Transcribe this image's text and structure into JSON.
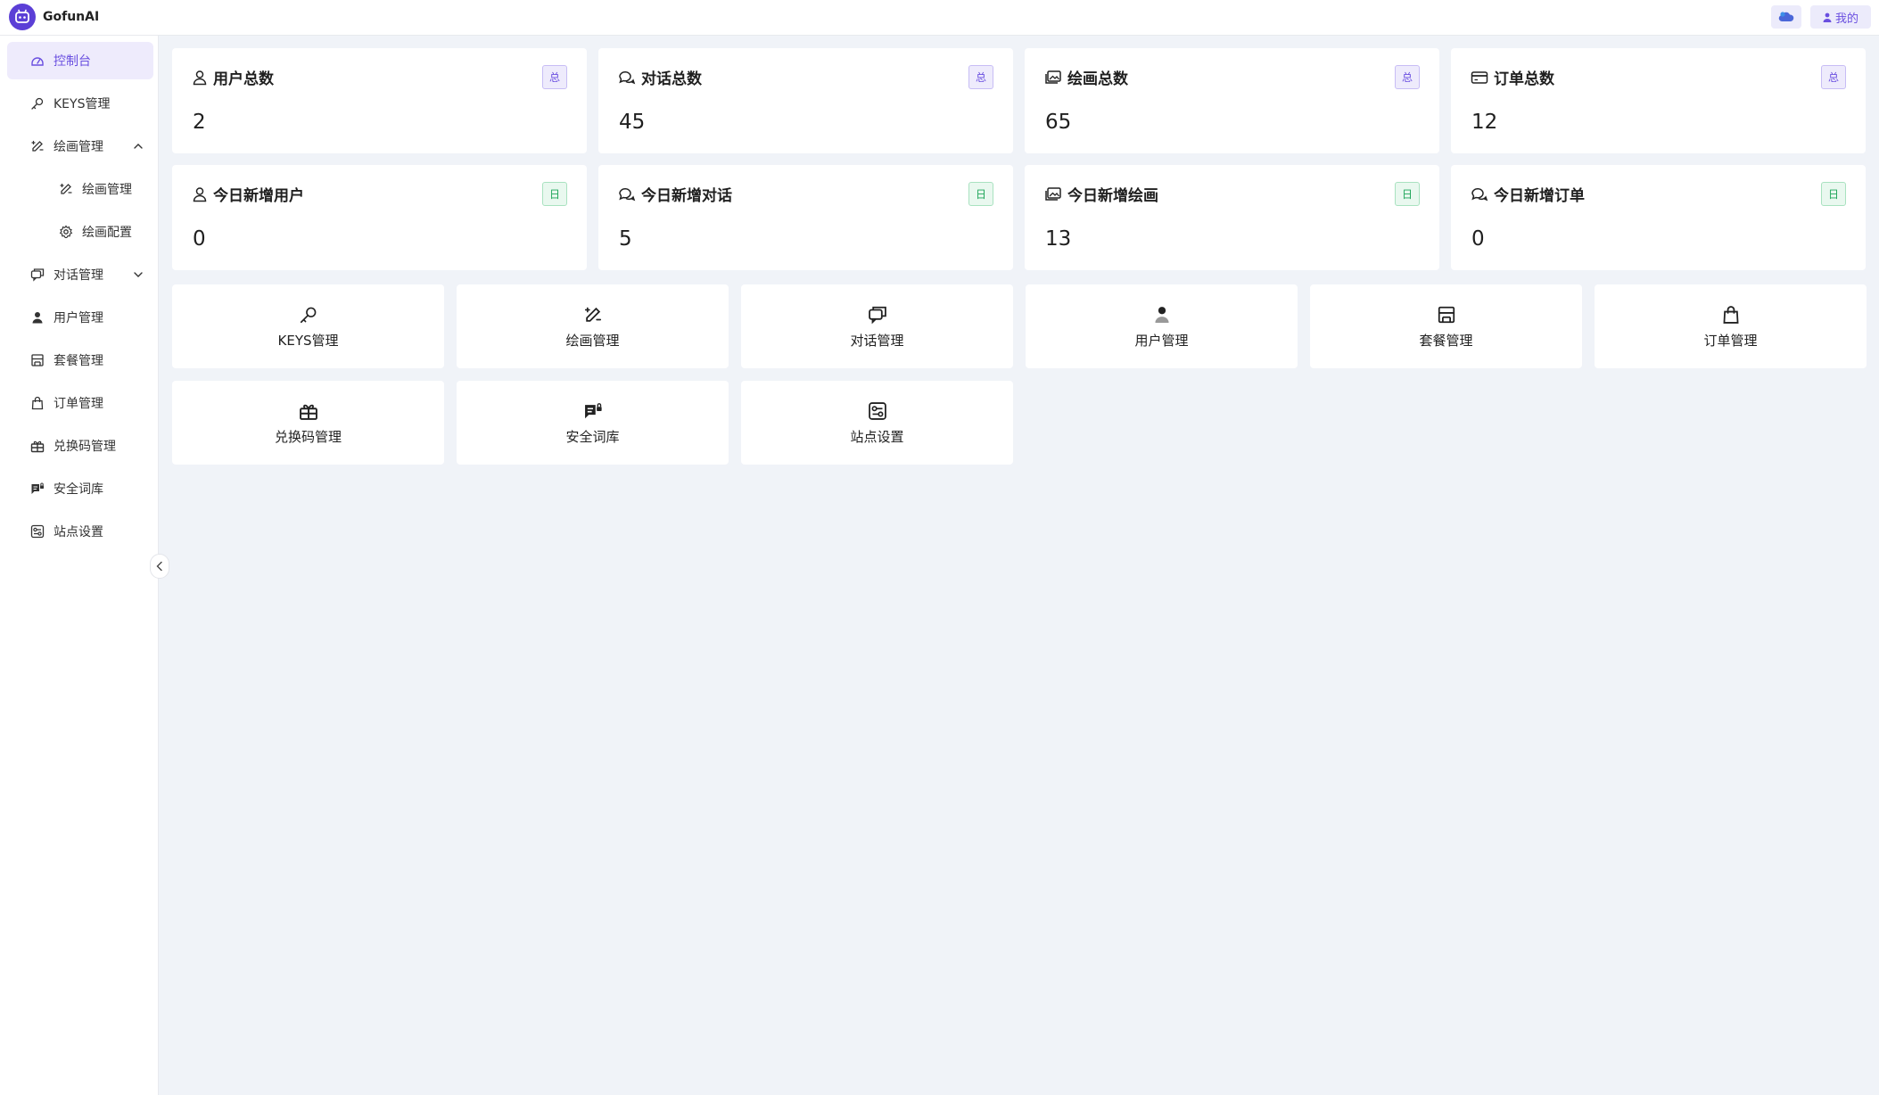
{
  "app": {
    "name": "GofunAI",
    "my_label": "我的"
  },
  "colors": {
    "accent": "#6a4fe0",
    "logo_bg": "#5b3fd6",
    "tag_total_bg": "#eeebfc",
    "tag_day_bg": "#e9f8ef",
    "tag_day_text": "#1fa65a",
    "page_bg": "#f0f3f8"
  },
  "sidebar": {
    "items": [
      {
        "label": "控制台",
        "icon": "dashboard-icon",
        "active": true
      },
      {
        "label": "KEYS管理",
        "icon": "key-icon"
      },
      {
        "label": "绘画管理",
        "icon": "draw-icon",
        "expanded": true
      },
      {
        "label": "绘画管理",
        "icon": "draw-icon",
        "sub": true
      },
      {
        "label": "绘画配置",
        "icon": "gear-icon",
        "sub": true
      },
      {
        "label": "对话管理",
        "icon": "chat-icon",
        "expanded": false
      },
      {
        "label": "用户管理",
        "icon": "user-icon"
      },
      {
        "label": "套餐管理",
        "icon": "store-icon"
      },
      {
        "label": "订单管理",
        "icon": "bag-icon"
      },
      {
        "label": "兑换码管理",
        "icon": "gift-icon"
      },
      {
        "label": "安全词库",
        "icon": "chat-lock-icon"
      },
      {
        "label": "站点设置",
        "icon": "settings-panel-icon"
      }
    ]
  },
  "stats": [
    {
      "title": "用户总数",
      "value": "2",
      "tag": "总",
      "icon": "user-outline-icon"
    },
    {
      "title": "对话总数",
      "value": "45",
      "tag": "总",
      "icon": "chats-icon"
    },
    {
      "title": "绘画总数",
      "value": "65",
      "tag": "总",
      "icon": "images-icon"
    },
    {
      "title": "订单总数",
      "value": "12",
      "tag": "总",
      "icon": "card-icon"
    },
    {
      "title": "今日新增用户",
      "value": "0",
      "tag": "日",
      "icon": "user-outline-icon"
    },
    {
      "title": "今日新增对话",
      "value": "5",
      "tag": "日",
      "icon": "chats-icon"
    },
    {
      "title": "今日新增绘画",
      "value": "13",
      "tag": "日",
      "icon": "images-icon"
    },
    {
      "title": "今日新增订单",
      "value": "0",
      "tag": "日",
      "icon": "chats-icon"
    }
  ],
  "shortcuts": [
    {
      "label": "KEYS管理",
      "icon": "key-icon"
    },
    {
      "label": "绘画管理",
      "icon": "draw-icon"
    },
    {
      "label": "对话管理",
      "icon": "chat-icon"
    },
    {
      "label": "用户管理",
      "icon": "user-icon"
    },
    {
      "label": "套餐管理",
      "icon": "store-icon"
    },
    {
      "label": "订单管理",
      "icon": "bag-icon"
    },
    {
      "label": "兑换码管理",
      "icon": "gift-icon"
    },
    {
      "label": "安全词库",
      "icon": "chat-lock-icon"
    },
    {
      "label": "站点设置",
      "icon": "settings-panel-icon"
    }
  ]
}
